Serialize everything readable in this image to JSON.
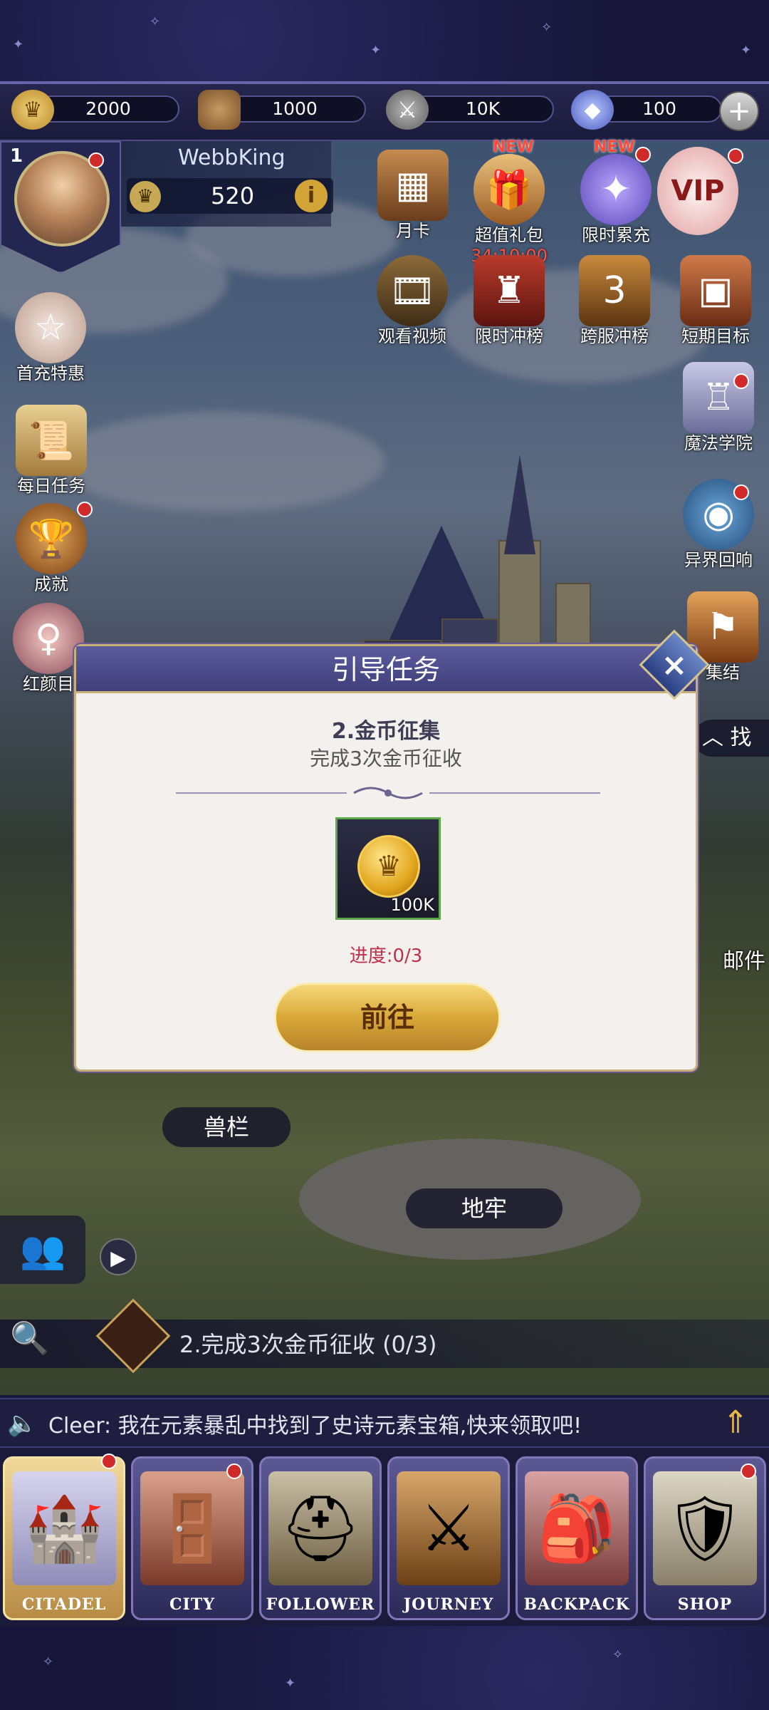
{
  "resources": [
    {
      "name": "gold",
      "value": "2000",
      "icon": "gold-coin-icon"
    },
    {
      "name": "wood",
      "value": "1000",
      "icon": "wood-log-icon"
    },
    {
      "name": "army",
      "value": "10K",
      "icon": "sword-icon"
    },
    {
      "name": "gem",
      "value": "100",
      "icon": "gem-icon"
    }
  ],
  "profile": {
    "level": "1",
    "username": "WebbKing",
    "power": "520"
  },
  "top_features": [
    {
      "label": "月卡",
      "new": ""
    },
    {
      "label": "超值礼包",
      "new": "NEW",
      "timer": "34:10:00"
    },
    {
      "label": "限时累充",
      "new": "NEW"
    },
    {
      "label": "VIP",
      "new": ""
    }
  ],
  "row2_features": [
    "观看视频",
    "限时冲榜",
    "跨服冲榜",
    "短期目标"
  ],
  "left_features": [
    "首充特惠",
    "每日任务",
    "成就",
    "红颜目"
  ],
  "right_features": [
    "魔法学院",
    "异界回响",
    "集结",
    "邮件",
    "找"
  ],
  "dialog": {
    "title": "引导任务",
    "task_name": "2.金币征集",
    "task_desc": "完成3次金币征收",
    "reward_amount": "100K",
    "progress": "进度:0/3",
    "go_button": "前往",
    "close_icon": "×"
  },
  "map_labels": {
    "pen": "兽栏",
    "dungeon": "地牢"
  },
  "quest_tracker": "2.完成3次金币征收 (0/3)",
  "chat": "Cleer: 我在元素暴乱中找到了史诗元素宝箱,快来领取吧!",
  "nav": [
    {
      "label": "CITADEL",
      "active": true
    },
    {
      "label": "CITY",
      "active": false
    },
    {
      "label": "FOLLOWER",
      "active": false
    },
    {
      "label": "JOURNEY",
      "active": false
    },
    {
      "label": "BACKPACK",
      "active": false
    },
    {
      "label": "SHOP",
      "active": false
    }
  ],
  "colors": {
    "accent": "#c8b07a",
    "dialog_header": "#4d4c8c",
    "progress_red": "#c0304a",
    "go_button": "#d9a838"
  }
}
